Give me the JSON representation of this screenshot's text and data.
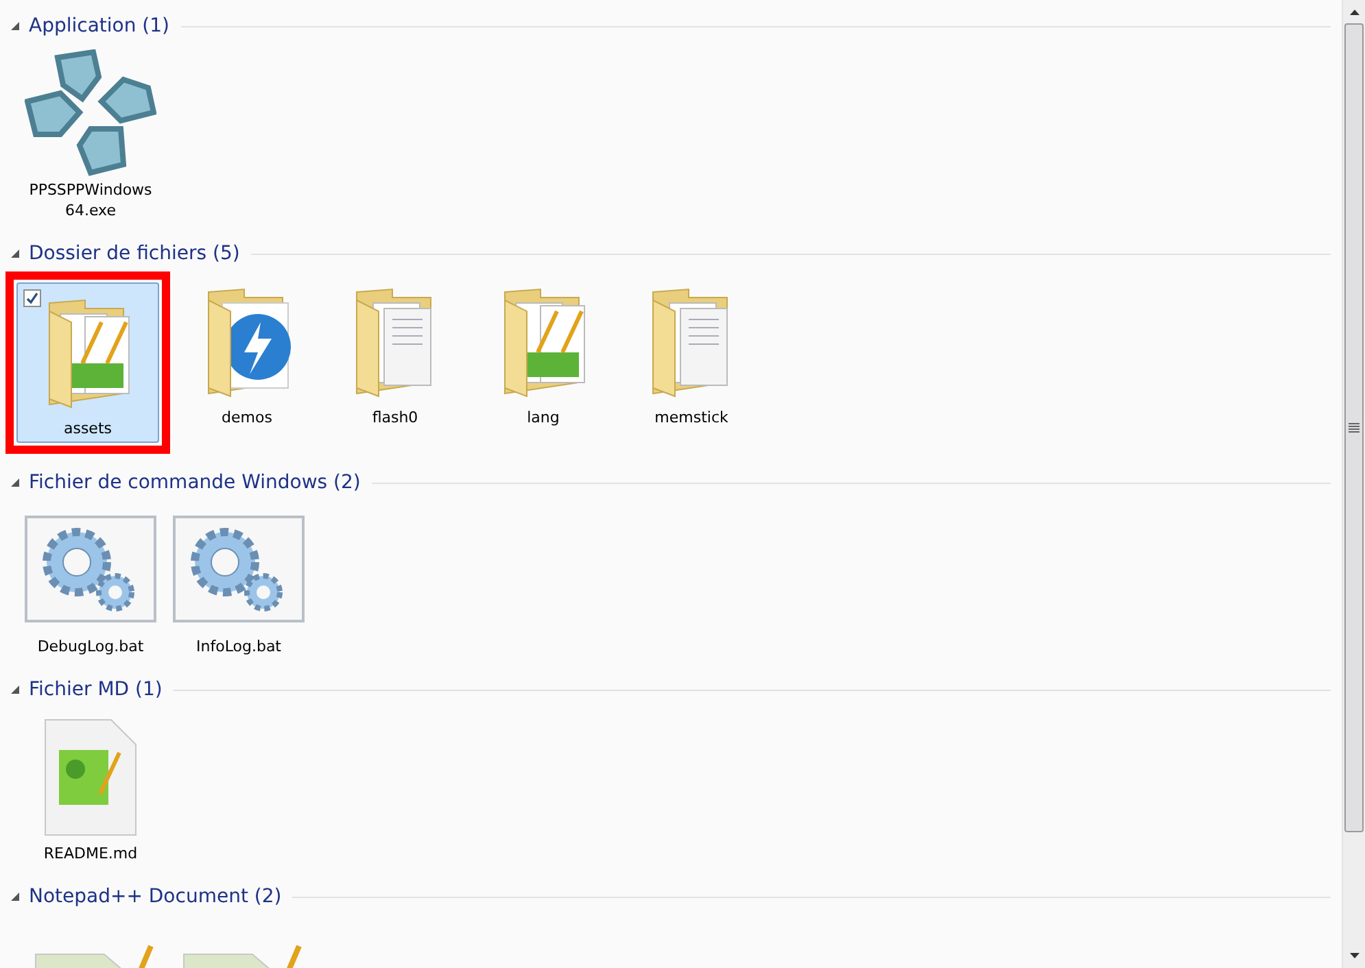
{
  "groups": [
    {
      "title": "Application (1)",
      "expanded": true,
      "items": [
        {
          "kind": "exe",
          "name": "PPSSPPWindows 64.exe",
          "selected": false,
          "checked": false,
          "highlighted": false
        }
      ]
    },
    {
      "title": "Dossier de fichiers (5)",
      "expanded": true,
      "items": [
        {
          "kind": "folder-docs",
          "name": "assets",
          "selected": true,
          "checked": true,
          "highlighted": true
        },
        {
          "kind": "folder-app",
          "name": "demos",
          "selected": false,
          "checked": false,
          "highlighted": false
        },
        {
          "kind": "folder",
          "name": "flash0",
          "selected": false,
          "checked": false,
          "highlighted": false
        },
        {
          "kind": "folder-docs",
          "name": "lang",
          "selected": false,
          "checked": false,
          "highlighted": false
        },
        {
          "kind": "folder",
          "name": "memstick",
          "selected": false,
          "checked": false,
          "highlighted": false
        }
      ]
    },
    {
      "title": "Fichier de commande Windows (2)",
      "expanded": true,
      "items": [
        {
          "kind": "bat",
          "name": "DebugLog.bat",
          "selected": false,
          "checked": false,
          "highlighted": false
        },
        {
          "kind": "bat",
          "name": "InfoLog.bat",
          "selected": false,
          "checked": false,
          "highlighted": false
        }
      ]
    },
    {
      "title": "Fichier MD (1)",
      "expanded": true,
      "items": [
        {
          "kind": "md",
          "name": "README.md",
          "selected": false,
          "checked": false,
          "highlighted": false
        }
      ]
    },
    {
      "title": "Notepad++ Document (2)",
      "expanded": true,
      "items": [
        {
          "kind": "npp",
          "selected": false,
          "checked": false,
          "highlighted": false
        },
        {
          "kind": "npp",
          "selected": false,
          "checked": false,
          "highlighted": false
        }
      ]
    }
  ]
}
